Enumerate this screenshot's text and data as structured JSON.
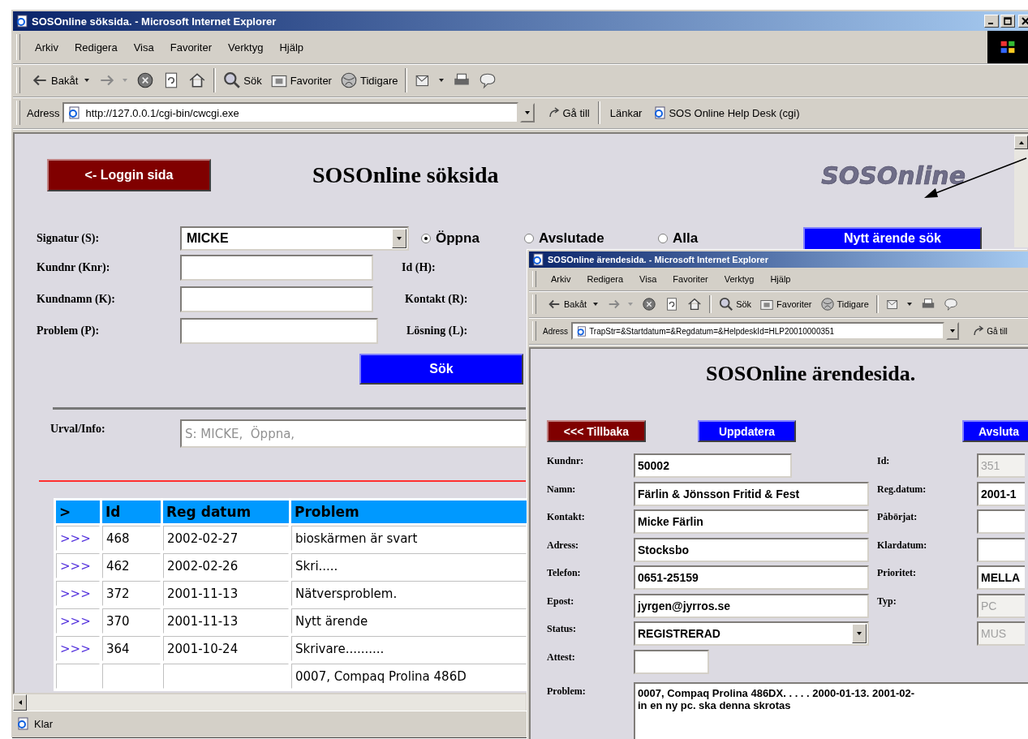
{
  "windows": [
    {
      "kind": "search",
      "title": "SOSOnline söksida. - Microsoft Internet Explorer",
      "title_buttons": [
        {
          "kind": "minimize"
        },
        {
          "kind": "maximize"
        },
        {
          "kind": "close"
        }
      ],
      "menu": [
        "Arkiv",
        "Redigera",
        "Visa",
        "Favoriter",
        "Verktyg",
        "Hjälp"
      ],
      "throbber": true,
      "toolbar": [
        {
          "kind": "back",
          "label": "Bakåt"
        },
        {
          "kind": "forward"
        },
        {
          "kind": "stop"
        },
        {
          "kind": "refresh"
        },
        {
          "kind": "home"
        },
        {
          "kind": "sep"
        },
        {
          "kind": "search",
          "label": "Sök"
        },
        {
          "kind": "favorites",
          "label": "Favoriter"
        },
        {
          "kind": "history",
          "label": "Tidigare"
        },
        {
          "kind": "sep"
        },
        {
          "kind": "mail"
        },
        {
          "kind": "print"
        },
        {
          "kind": "discuss"
        }
      ],
      "address": {
        "label": "Adress",
        "value": "http://127.0.0.1/cgi-bin/cwcgi.exe",
        "go": "Gå till",
        "links_label": "Länkar",
        "link": "SOS Online Help Desk (cgi)"
      },
      "page": {
        "back_button": "<- Loggin sida",
        "heading": "SOSOnline söksida",
        "logo": "SOSOnline",
        "signature": {
          "label": "Signatur (S):",
          "value": "MICKE"
        },
        "radios": [
          {
            "label": "Öppna",
            "selected": true
          },
          {
            "label": "Avslutade",
            "selected": false
          },
          {
            "label": "Alla",
            "selected": false
          }
        ],
        "new_search_button": "Nytt ärende sök",
        "fields": [
          {
            "label": "Kundnr (Knr):"
          },
          {
            "label": "Kundnamn (K):"
          },
          {
            "label": "Problem (P):"
          }
        ],
        "right_labels": [
          "Id (H):",
          "Kontakt (R):",
          "Lösning (L):"
        ],
        "search_button": "Sök",
        "selection": {
          "label": "Urval/Info:",
          "value": "S: MICKE,  Öppna,"
        },
        "table": {
          "columns": [
            ">",
            "Id",
            "Reg datum",
            "Problem"
          ],
          "rows": [
            {
              "link": ">>>",
              "id": "468",
              "date": "2002-02-27",
              "problem": "bioskärmen är svart"
            },
            {
              "link": ">>>",
              "id": "462",
              "date": "2002-02-26",
              "problem": "Skri....."
            },
            {
              "link": ">>>",
              "id": "372",
              "date": "2001-11-13",
              "problem": "Nätversproblem."
            },
            {
              "link": ">>>",
              "id": "370",
              "date": "2001-11-13",
              "problem": "Nytt ärende"
            },
            {
              "link": ">>>",
              "id": "364",
              "date": "2001-10-24",
              "problem": "Skrivare.........."
            },
            {
              "problem": "0007, Compaq Prolina 486D"
            }
          ]
        }
      },
      "status_bar": "Klar"
    },
    {
      "kind": "case",
      "title": "SOSOnline ärendesida. - Microsoft Internet Explorer",
      "menu": [
        "Arkiv",
        "Redigera",
        "Visa",
        "Favoriter",
        "Verktyg",
        "Hjälp"
      ],
      "throbber": false,
      "toolbar": [
        {
          "kind": "back",
          "label": "Bakåt"
        },
        {
          "kind": "forward"
        },
        {
          "kind": "stop"
        },
        {
          "kind": "refresh"
        },
        {
          "kind": "home"
        },
        {
          "kind": "sep"
        },
        {
          "kind": "search",
          "label": "Sök"
        },
        {
          "kind": "favorites",
          "label": "Favoriter"
        },
        {
          "kind": "history",
          "label": "Tidigare"
        },
        {
          "kind": "sep"
        },
        {
          "kind": "mail"
        },
        {
          "kind": "print"
        },
        {
          "kind": "discuss"
        }
      ],
      "address": {
        "label": "Adress",
        "value": "TrapStr=&Startdatum=&Regdatum=&HelpdeskId=HLP20010000351",
        "go": "Gå till"
      },
      "page": {
        "heading": "SOSOnline ärendesida.",
        "buttons": [
          {
            "kind": "back",
            "label": "<<< Tillbaka"
          },
          {
            "kind": "action",
            "label": "Uppdatera"
          },
          {
            "kind": "action",
            "label": "Avsluta"
          }
        ],
        "left_fields": [
          {
            "label": "Kundnr:",
            "value": "50002",
            "kind": "short"
          },
          {
            "label": "Namn:",
            "value": "Färlin & Jönsson Fritid & Fest",
            "kind": "text"
          },
          {
            "label": "Kontakt:",
            "value": "Micke Färlin",
            "kind": "text"
          },
          {
            "label": "Adress:",
            "value": "Stocksbo",
            "kind": "text"
          },
          {
            "label": "Telefon:",
            "value": "0651-25159",
            "kind": "text"
          },
          {
            "label": "Epost:",
            "value": "jyrgen@jyrros.se",
            "kind": "text"
          },
          {
            "label": "Status:",
            "value": "REGISTRERAD",
            "kind": "select"
          },
          {
            "label": "Attest:",
            "kind": "tiny"
          }
        ],
        "right_fields": [
          {
            "label": "Id:",
            "value": "351",
            "disabled": true
          },
          {
            "label": "Reg.datum:",
            "value": "2001-1",
            "disabled": false
          },
          {
            "label": "Påbörjat:",
            "disabled": false
          },
          {
            "label": "Klardatum:",
            "disabled": false
          },
          {
            "label": "Prioritet:",
            "value": "MELLA",
            "disabled": false
          },
          {
            "label": "Typ:",
            "value": "PC",
            "disabled": true
          },
          {
            "value": "MUS",
            "disabled": true
          }
        ],
        "problem": {
          "label": "Problem:",
          "lines": [
            "0007, Compaq Prolina 486DX. . . . . 2000-01-13. 2001-02-",
            "in en ny pc. ska denna skrotas"
          ]
        }
      }
    }
  ]
}
